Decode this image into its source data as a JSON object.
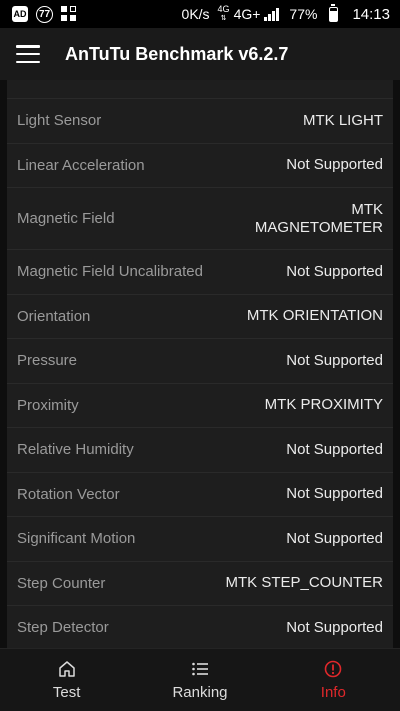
{
  "status_bar": {
    "ad_badge": "AD",
    "notification_count": "77",
    "net_speed": "0K/s",
    "net_type_small": "4G",
    "net_type_small2": "4G+",
    "battery": "77%",
    "battery_level": 0.77,
    "time": "14:13"
  },
  "app_bar": {
    "title": "AnTuTu Benchmark v6.2.7"
  },
  "sensors": [
    {
      "name": "Light Sensor",
      "value": "MTK LIGHT"
    },
    {
      "name": "Linear Acceleration",
      "value": "Not Supported"
    },
    {
      "name": "Magnetic Field",
      "value": "MTK MAGNETOMETER"
    },
    {
      "name": "Magnetic Field Uncalibrated",
      "value": "Not Supported"
    },
    {
      "name": "Orientation",
      "value": "MTK ORIENTATION"
    },
    {
      "name": "Pressure",
      "value": "Not Supported"
    },
    {
      "name": "Proximity",
      "value": "MTK PROXIMITY"
    },
    {
      "name": "Relative Humidity",
      "value": "Not Supported"
    },
    {
      "name": "Rotation Vector",
      "value": "Not Supported"
    },
    {
      "name": "Significant Motion",
      "value": "Not Supported"
    },
    {
      "name": "Step Counter",
      "value": "MTK STEP_COUNTER"
    },
    {
      "name": "Step Detector",
      "value": "Not Supported"
    }
  ],
  "bottom_nav": {
    "test": "Test",
    "ranking": "Ranking",
    "info": "Info",
    "active_color": "#e0282b"
  }
}
